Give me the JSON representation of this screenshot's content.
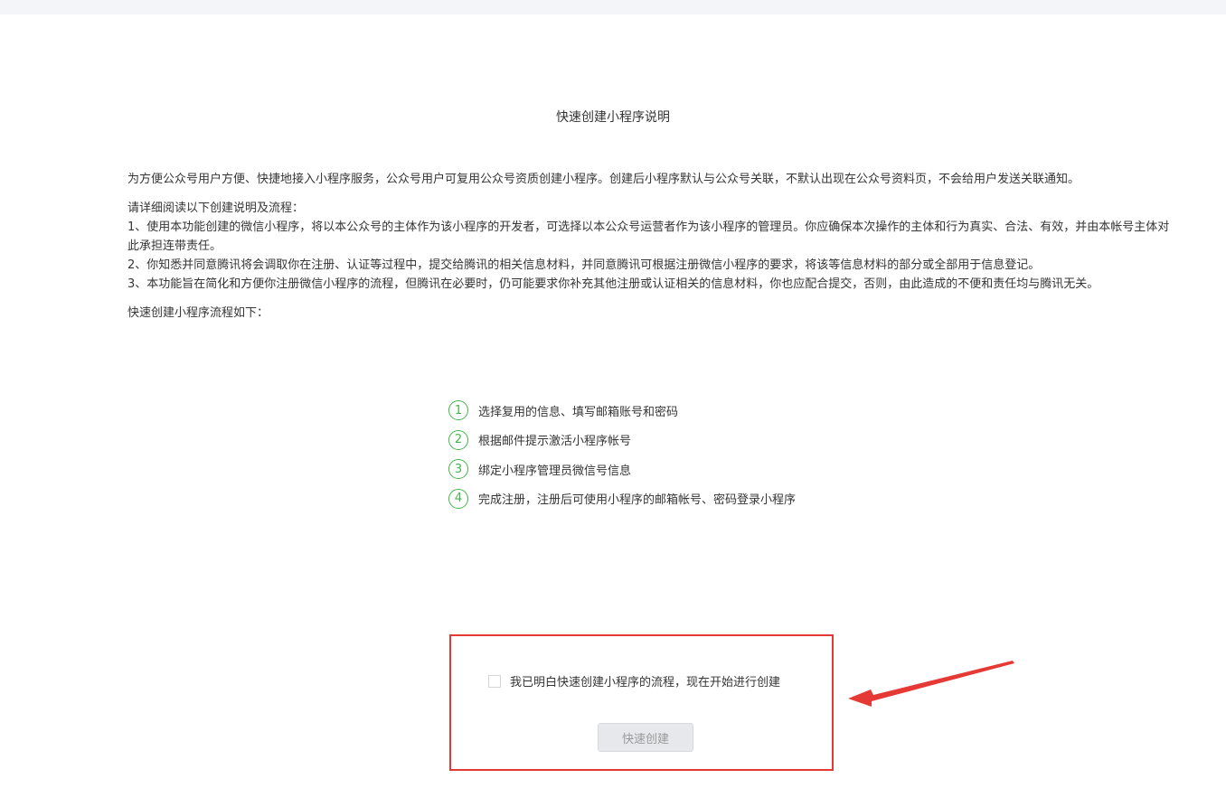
{
  "page_title": "快速创建小程序说明",
  "intro": "为方便公众号用户方便、快捷地接入小程序服务，公众号用户可复用公众号资质创建小程序。创建后小程序默认与公众号关联，不默认出现在公众号资料页，不会给用户发送关联通知。",
  "instructions": {
    "heading": "请详细阅读以下创建说明及流程：",
    "items": [
      "1、使用本功能创建的微信小程序，将以本公众号的主体作为该小程序的开发者，可选择以本公众号运营者作为该小程序的管理员。你应确保本次操作的主体和行为真实、合法、有效，并由本帐号主体对此承担连带责任。",
      "2、你知悉并同意腾讯将会调取你在注册、认证等过程中，提交给腾讯的相关信息材料，并同意腾讯可根据注册微信小程序的要求，将该等信息材料的部分或全部用于信息登记。",
      "3、本功能旨在简化和方便你注册微信小程序的流程，但腾讯在必要时，仍可能要求你补充其他注册或认证相关的信息材料，你也应配合提交，否则，由此造成的不便和责任均与腾讯无关。"
    ]
  },
  "flow_title": "快速创建小程序流程如下：",
  "steps": [
    {
      "num": "1",
      "label": "选择复用的信息、填写邮箱账号和密码"
    },
    {
      "num": "2",
      "label": "根据邮件提示激活小程序帐号"
    },
    {
      "num": "3",
      "label": "绑定小程序管理员微信号信息"
    },
    {
      "num": "4",
      "label": "完成注册，注册后可使用小程序的邮箱帐号、密码登录小程序"
    }
  ],
  "agreement": {
    "label": "我已明白快速创建小程序的流程，现在开始进行创建",
    "checked": false
  },
  "create_button": "快速创建",
  "colors": {
    "accent_green": "#44b549",
    "highlight_red": "#e53935",
    "button_disabled_bg": "#e7e8eb"
  }
}
